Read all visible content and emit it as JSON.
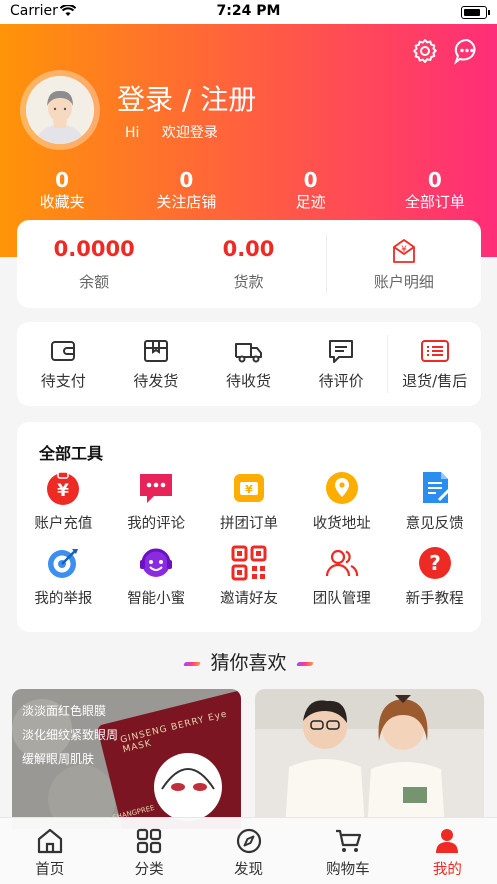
{
  "status": {
    "carrier": "Carrier",
    "time": "7:24 PM"
  },
  "header": {
    "title": "登录 / 注册",
    "hi": "Hi",
    "welcome": "欢迎登录",
    "icons": [
      "gear-icon",
      "chat-icon"
    ]
  },
  "stats": [
    {
      "value": "0",
      "label": "收藏夹"
    },
    {
      "value": "0",
      "label": "关注店铺"
    },
    {
      "value": "0",
      "label": "足迹"
    },
    {
      "value": "0",
      "label": "全部订单"
    }
  ],
  "wallet": {
    "balance_value": "0.0000",
    "balance_label": "余额",
    "payment_value": "0.00",
    "payment_label": "货款",
    "details_label": "账户明细"
  },
  "orders": [
    {
      "label": "待支付",
      "icon": "wallet-icon"
    },
    {
      "label": "待发货",
      "icon": "box-icon"
    },
    {
      "label": "待收货",
      "icon": "truck-icon"
    },
    {
      "label": "待评价",
      "icon": "comment-icon"
    },
    {
      "label": "退货/售后",
      "icon": "list-icon"
    }
  ],
  "tools": {
    "title": "全部工具",
    "items": [
      {
        "label": "账户充值",
        "icon": "recharge-icon"
      },
      {
        "label": "我的评论",
        "icon": "comment-bubble-icon"
      },
      {
        "label": "拼团订单",
        "icon": "group-order-icon"
      },
      {
        "label": "收货地址",
        "icon": "location-icon"
      },
      {
        "label": "意见反馈",
        "icon": "feedback-icon"
      },
      {
        "label": "我的举报",
        "icon": "report-target-icon"
      },
      {
        "label": "智能小蜜",
        "icon": "assistant-icon"
      },
      {
        "label": "邀请好友",
        "icon": "qr-code-icon"
      },
      {
        "label": "团队管理",
        "icon": "team-icon"
      },
      {
        "label": "新手教程",
        "icon": "help-icon"
      }
    ]
  },
  "guess": {
    "title": "猜你喜欢"
  },
  "products": [
    {
      "caption_lines": [
        "淡淡面红色眼膜",
        "淡化细纹紧致眼周",
        "缓解眼周肌肤"
      ],
      "brand": "GINSENG BERRY Eye MASK",
      "brand_small": "SHANGPREE"
    },
    {
      "image": "couple-tshirt-photo"
    }
  ],
  "tabbar": [
    {
      "label": "首页",
      "icon": "home-icon"
    },
    {
      "label": "分类",
      "icon": "category-icon"
    },
    {
      "label": "发现",
      "icon": "compass-icon"
    },
    {
      "label": "购物车",
      "icon": "cart-icon"
    },
    {
      "label": "我的",
      "icon": "profile-icon",
      "active": true
    }
  ],
  "colors": {
    "accent": "#ee2a24",
    "gradient_start": "#ff9408",
    "gradient_end": "#ff2d78"
  }
}
